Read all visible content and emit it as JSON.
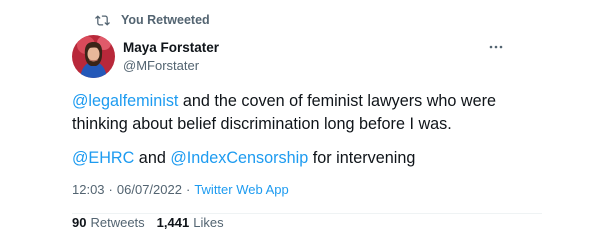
{
  "retweet": {
    "label": "You Retweeted",
    "icon": "retweet-icon"
  },
  "author": {
    "display_name": "Maya Forstater",
    "handle": "@MForstater",
    "avatar_icon": "avatar"
  },
  "tweet": {
    "line1_mention": "@legalfeminist",
    "line1_text": " and the coven of feminist lawyers who were thinking about belief discrimination long before I was.",
    "line2_mention1": "@EHRC",
    "line2_and": " and ",
    "line2_mention2": "@IndexCensorship",
    "line2_text": " for intervening"
  },
  "meta": {
    "time": "12:03",
    "separator": "·",
    "date": "06/07/2022",
    "app": "Twitter Web App"
  },
  "stats": {
    "retweets_count": "90",
    "retweets_label": "Retweets",
    "likes_count": "1,441",
    "likes_label": "Likes"
  },
  "colors": {
    "link": "#1d9bf0",
    "secondary_text": "#536471",
    "primary_text": "#0f1419"
  }
}
